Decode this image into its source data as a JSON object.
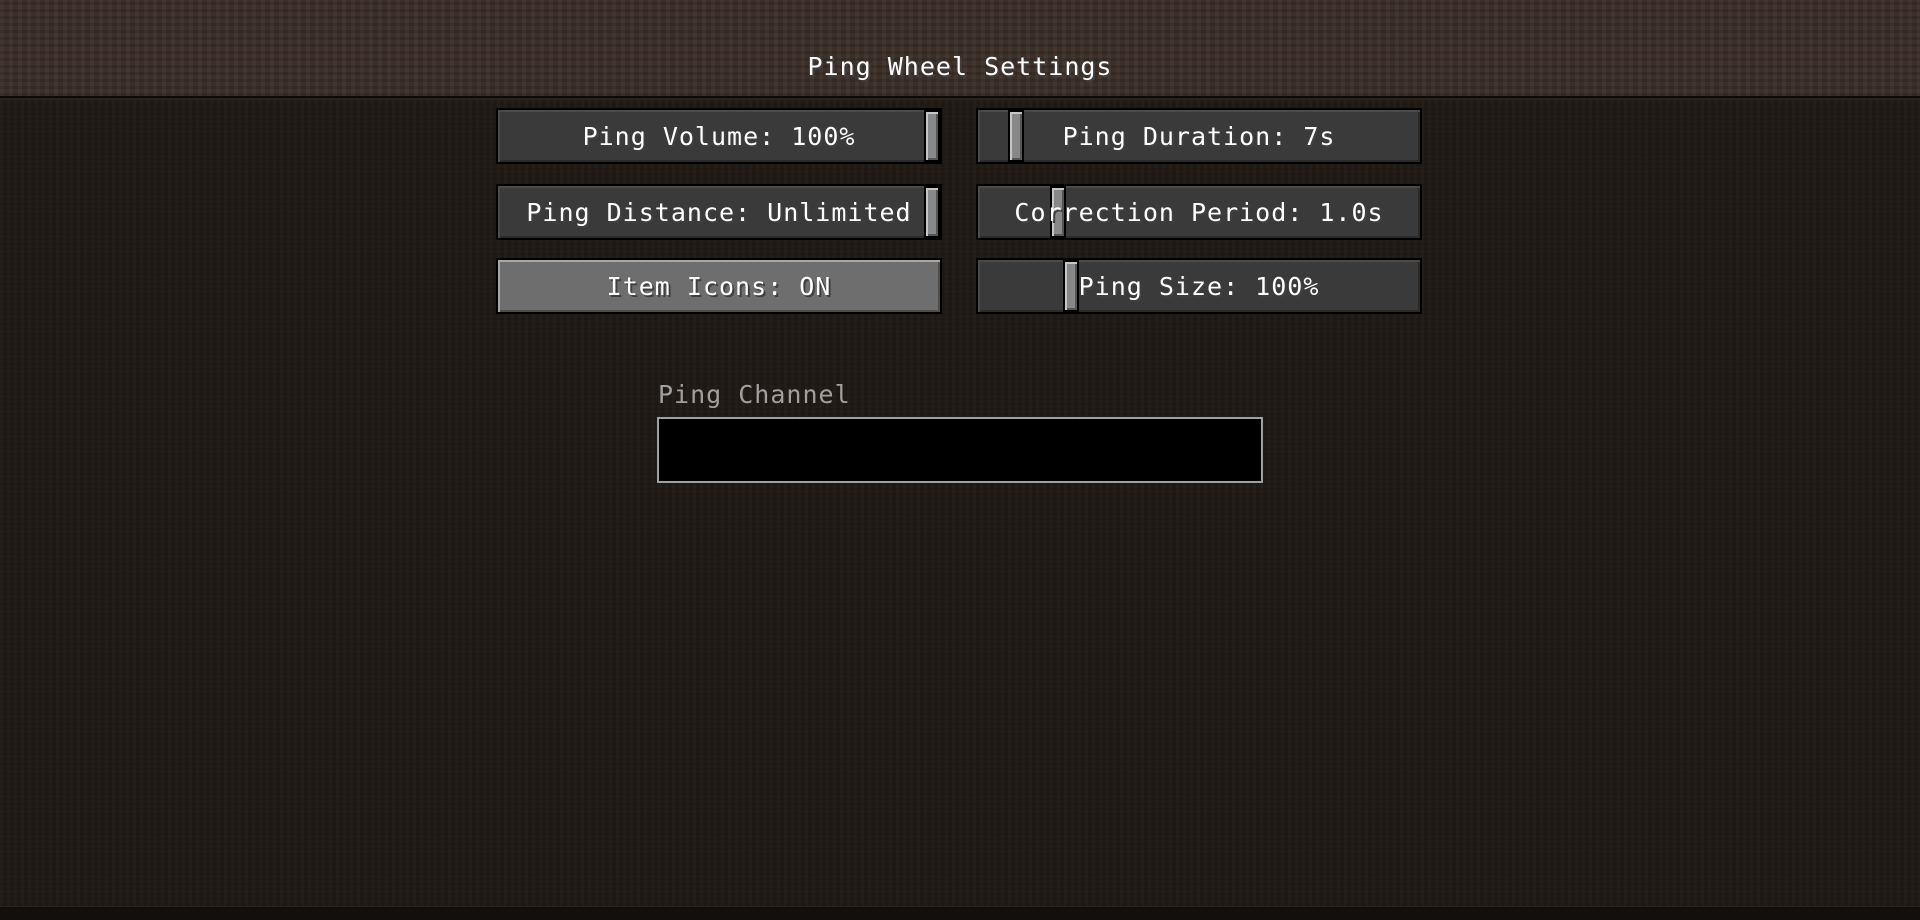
{
  "screen": {
    "title": "Ping Wheel Settings"
  },
  "settings": {
    "ping_volume": {
      "label": "Ping Volume: 100%",
      "value_fraction": 1.0
    },
    "ping_duration": {
      "label": "Ping Duration: 7s",
      "value_fraction": 0.07
    },
    "ping_distance": {
      "label": "Ping Distance: Unlimited",
      "value_fraction": 1.0
    },
    "correction_period": {
      "label": "Correction Period: 1.0s",
      "value_fraction": 0.17
    },
    "item_icons": {
      "label": "Item Icons: ON"
    },
    "ping_size": {
      "label": "Ping Size: 100%",
      "value_fraction": 0.2
    }
  },
  "channel": {
    "label": "Ping Channel",
    "value": ""
  }
}
